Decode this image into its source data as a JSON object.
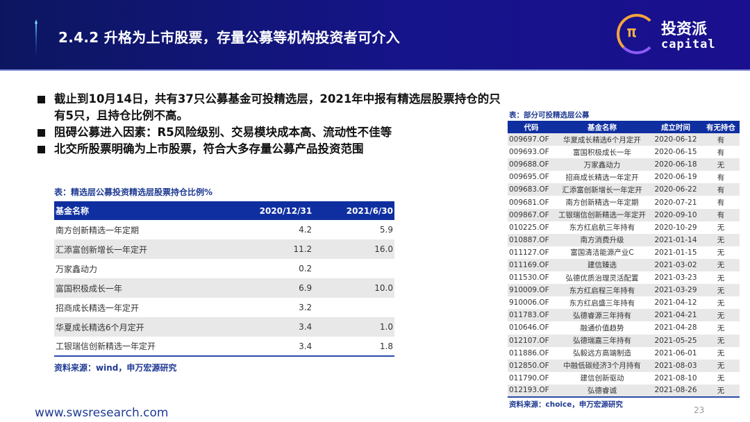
{
  "header": {
    "title": "2.4.2 升格为上市股票，存量公募等机构投资者可介入",
    "logo_cn": "投资派",
    "logo_en": "capital",
    "logo_mark": "π"
  },
  "bullets": [
    "截止到10月14日，共有37只公募基金可投精选层，2021年中报有精选层股票持仓的只有5只，且持仓比例不高。",
    "阻碍公募进入因素：R5风险级别、交易模块成本高、流动性不佳等",
    "北交所股票明确为上市股票，符合大多存量公募产品投资范围"
  ],
  "left_table": {
    "caption": "表：精选层公募投资精选层股票持仓比例%",
    "headers": [
      "基金名称",
      "2020/12/31",
      "2021/6/30"
    ],
    "rows": [
      [
        "南方创新精选一年定期",
        "4.2",
        "5.9"
      ],
      [
        "汇添富创新增长一年定开",
        "11.2",
        "16.0"
      ],
      [
        "万家鑫动力",
        "0.2",
        ""
      ],
      [
        "富国积极成长一年",
        "6.9",
        "10.0"
      ],
      [
        "招商成长精选一年定开",
        "3.2",
        ""
      ],
      [
        "华夏成长精选6个月定开",
        "3.4",
        "1.0"
      ],
      [
        "工银瑞信创新精选一年定开",
        "3.4",
        "1.8"
      ]
    ],
    "source": "资料来源：wind，申万宏源研究"
  },
  "right_table": {
    "caption": "表：部分可投精选层公募",
    "headers": [
      "代码",
      "基金名称",
      "成立时间",
      "有无持仓"
    ],
    "rows": [
      [
        "009697.OF",
        "华夏成长精选6个月定开",
        "2020-06-12",
        "有"
      ],
      [
        "009693.OF",
        "富国积极成长一年",
        "2020-06-15",
        "有"
      ],
      [
        "009688.OF",
        "万家鑫动力",
        "2020-06-18",
        "无"
      ],
      [
        "009695.OF",
        "招商成长精选一年定开",
        "2020-06-19",
        "有"
      ],
      [
        "009683.OF",
        "汇添富创新增长一年定开",
        "2020-06-22",
        "有"
      ],
      [
        "009681.OF",
        "南方创新精选一年定期",
        "2020-07-21",
        "有"
      ],
      [
        "009867.OF",
        "工银瑞信创新精选一年定开",
        "2020-09-10",
        "有"
      ],
      [
        "010225.OF",
        "东方红启航三年持有",
        "2020-10-29",
        "无"
      ],
      [
        "010887.OF",
        "南方消费升级",
        "2021-01-14",
        "无"
      ],
      [
        "011127.OF",
        "富国清洁能源产业C",
        "2021-01-15",
        "无"
      ],
      [
        "011169.OF",
        "建信臻选",
        "2021-03-02",
        "无"
      ],
      [
        "011530.OF",
        "弘德优质治理灵活配置",
        "2021-03-23",
        "无"
      ],
      [
        "910009.OF",
        "东方红启程三年持有",
        "2021-03-29",
        "无"
      ],
      [
        "910006.OF",
        "东方红启盛三年持有",
        "2021-04-12",
        "无"
      ],
      [
        "011783.OF",
        "弘德睿源三年持有",
        "2021-04-21",
        "无"
      ],
      [
        "010646.OF",
        "融通价值趋势",
        "2021-04-28",
        "无"
      ],
      [
        "012107.OF",
        "弘德瑞嘉三年持有",
        "2021-05-25",
        "无"
      ],
      [
        "011886.OF",
        "弘毅远方高端制造",
        "2021-06-01",
        "无"
      ],
      [
        "012850.OF",
        "中融低碳经济3个月持有",
        "2021-08-03",
        "无"
      ],
      [
        "011790.OF",
        "建信创新驱动",
        "2021-08-10",
        "无"
      ],
      [
        "012193.OF",
        "弘德睿诚",
        "2021-08-26",
        "无"
      ]
    ],
    "source": "资料来源：choice，申万宏源研究"
  },
  "footer": {
    "url": "www.swsresearch.com",
    "page": "23"
  }
}
